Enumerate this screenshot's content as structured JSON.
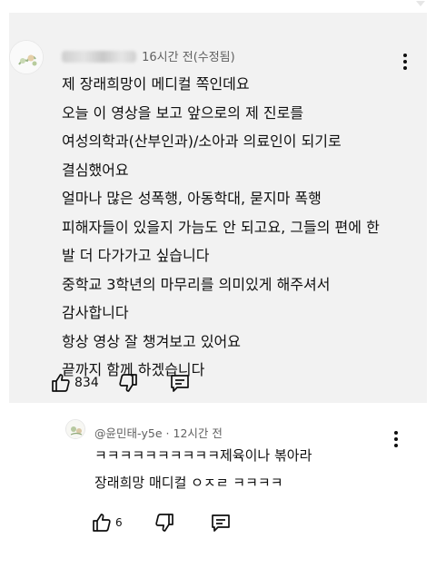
{
  "comment": {
    "author_masked": "",
    "time": "16시간 전(수정됨)",
    "lines": [
      "제 장래희망이 메디컬 쪽인데요",
      "오늘 이 영상을 보고 앞으로의 제 진로를",
      "여성의학과(산부인과)/소아과 의료인이 되기로",
      "결심했어요",
      "얼마나 많은 성폭행, 아동학대, 묻지마 폭행",
      "피해자들이 있을지 가늠도 안 되고요, 그들의 편에 한",
      "발 더 다가가고 싶습니다",
      "중학교 3학년의 마무리를 의미있게 해주셔서",
      "감사합니다",
      "항상 영상 잘 챙겨보고 있어요",
      "끝까지 함께 하겠습니다"
    ],
    "like_count": "834",
    "icons": {
      "like": "thumbs-up-icon",
      "dislike": "thumbs-down-icon",
      "reply": "reply-icon",
      "menu": "more-vertical-icon"
    }
  },
  "reply": {
    "author": "@윤민태-y5e",
    "separator": "·",
    "time": "12시간 전",
    "lines": [
      "ㅋㅋㅋㅋㅋㅋㅋㅋㅋㅋ제육이나 볶아라",
      "장래희망 매디컬 ㅇㅈㄹ ㅋㅋㅋㅋ"
    ],
    "like_count": "6"
  },
  "colors": {
    "comment_bg": "#f2f2f2",
    "meta_text": "#606060",
    "body_text": "#0f0f0f"
  }
}
